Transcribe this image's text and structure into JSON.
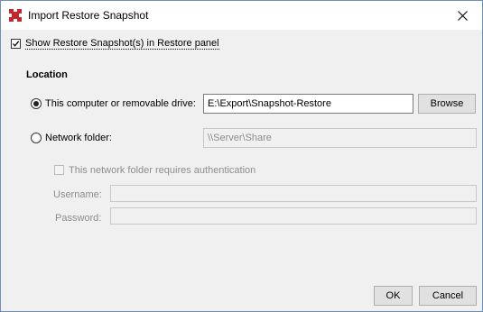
{
  "window": {
    "title": "Import Restore Snapshot"
  },
  "options": {
    "show_in_panel_label": "Show Restore Snapshot(s) in Restore panel",
    "show_in_panel_checked": true
  },
  "location": {
    "heading": "Location",
    "local_label": "This computer or removable drive:",
    "local_path": "E:\\Export\\Snapshot-Restore",
    "browse_label": "Browse",
    "network_label": "Network folder:",
    "network_placeholder": "\\\\Server\\Share",
    "auth_label": "This network folder requires authentication",
    "username_label": "Username:",
    "password_label": "Password:"
  },
  "footer": {
    "ok_label": "OK",
    "cancel_label": "Cancel"
  },
  "colors": {
    "brand": "#c1272d",
    "border": "#6f8fb8"
  }
}
